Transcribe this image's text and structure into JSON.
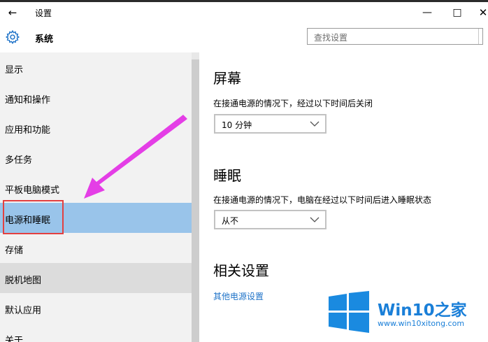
{
  "window": {
    "title": "设置",
    "back_icon": "back-arrow-icon",
    "minimize_icon": "minimize-icon",
    "maximize_icon": "maximize-icon",
    "close_icon": "close-icon"
  },
  "header": {
    "title": "系统",
    "icon": "gear-icon",
    "search_placeholder": "查找设置"
  },
  "sidebar": {
    "items": [
      {
        "label": "显示"
      },
      {
        "label": "通知和操作"
      },
      {
        "label": "应用和功能"
      },
      {
        "label": "多任务"
      },
      {
        "label": "平板电脑模式"
      },
      {
        "label": "电源和睡眠",
        "selected": true
      },
      {
        "label": "存储"
      },
      {
        "label": "脱机地图"
      },
      {
        "label": "默认应用"
      },
      {
        "label": "关于"
      }
    ]
  },
  "content": {
    "screen": {
      "heading": "屏幕",
      "description": "在接通电源的情况下，经过以下时间后关闭",
      "dropdown_value": "10 分钟"
    },
    "sleep": {
      "heading": "睡眠",
      "description": "在接通电源的情况下，电脑在经过以下时间后进入睡眠状态",
      "dropdown_value": "从不"
    },
    "related": {
      "heading": "相关设置",
      "link": "其他电源设置"
    }
  },
  "watermark": {
    "brand": "Win10",
    "brand_suffix": "之家",
    "url": "www.win10xitong.com"
  },
  "colors": {
    "accent": "#1f73c8",
    "selected_bg": "#99c4ea",
    "sidebar_bg": "#f2f2f2",
    "annotation_red": "#e34040",
    "annotation_arrow": "#e43ee6"
  }
}
